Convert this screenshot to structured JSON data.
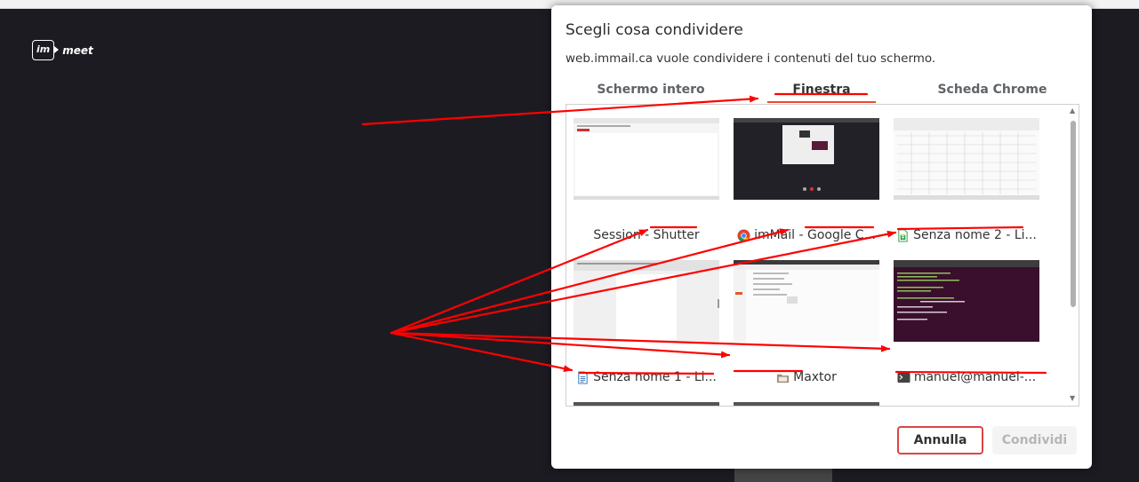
{
  "background": {
    "logo_im": "im",
    "logo_meet": "meet"
  },
  "dialog": {
    "title": "Scegli cosa condividere",
    "subtitle": "web.immail.ca vuole condividere i contenuti del tuo schermo.",
    "tabs": [
      {
        "label": "Schermo intero",
        "active": false
      },
      {
        "label": "Finestra",
        "active": true
      },
      {
        "label": "Scheda Chrome",
        "active": false
      }
    ],
    "windows": [
      {
        "label": "Session - Shutter",
        "icon": "none"
      },
      {
        "label": "imMail - Google C...",
        "icon": "chrome-icon"
      },
      {
        "label": "Senza nome 2 - Li...",
        "icon": "spreadsheet-icon"
      },
      {
        "label": "Senza nome 1 - Li...",
        "icon": "document-icon"
      },
      {
        "label": "Maxtor",
        "icon": "folder-icon"
      },
      {
        "label": "manuel@manuel-...",
        "icon": "terminal-icon"
      }
    ],
    "cancel_label": "Annulla",
    "share_label": "Condividi"
  },
  "colors": {
    "accent": "#e84c2e",
    "annotation": "#ff0000",
    "background": "#1d1b22"
  }
}
